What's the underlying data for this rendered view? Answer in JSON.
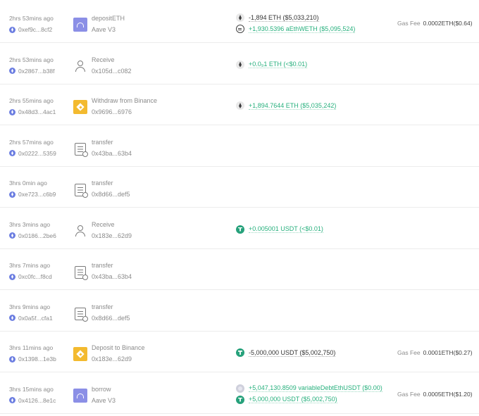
{
  "rows": [
    {
      "time": "2hrs 53mins ago",
      "hash": "0xef9c...8cf2",
      "icon": "aave-icon",
      "name": "depositETH",
      "sub": "Aave V3",
      "tokens": [
        {
          "icon": "eth-icon",
          "text": "-1,894 ETH ($5,033,210)",
          "direction": "out"
        },
        {
          "icon": "aeth-icon",
          "text": "+1,930.5396 aEthWETH ($5,095,524)",
          "direction": "in"
        }
      ],
      "gas_label": "Gas Fee",
      "gas_value": "0.0002ETH($0.64)"
    },
    {
      "time": "2hrs 53mins ago",
      "hash": "0x2867...b38f",
      "icon": "person-icon",
      "name": "Receive",
      "sub": "0x105d...c082",
      "tokens": [
        {
          "icon": "eth-icon",
          "text": "+0.0₉1 ETH (<$0.01)",
          "direction": "in"
        }
      ]
    },
    {
      "time": "2hrs 55mins ago",
      "hash": "0x48d3...4ac1",
      "icon": "binance-icon",
      "name": "Withdraw from Binance",
      "sub": "0x9696...6976",
      "tokens": [
        {
          "icon": "eth-icon",
          "text": "+1,894.7644 ETH ($5,035,242)",
          "direction": "in"
        }
      ]
    },
    {
      "time": "2hrs 57mins ago",
      "hash": "0x0222...5359",
      "icon": "contract-icon",
      "name": "transfer",
      "sub": "0x43ba...63b4",
      "tokens": []
    },
    {
      "time": "3hrs 0min ago",
      "hash": "0xe723...c6b9",
      "icon": "contract-icon",
      "name": "transfer",
      "sub": "0x8d66...def5",
      "tokens": []
    },
    {
      "time": "3hrs 3mins ago",
      "hash": "0x0186...2be6",
      "icon": "person-icon",
      "name": "Receive",
      "sub": "0x183e...62d9",
      "tokens": [
        {
          "icon": "usdt-icon",
          "text": "+0.005001 USDT (<$0.01)",
          "direction": "in"
        }
      ]
    },
    {
      "time": "3hrs 7mins ago",
      "hash": "0xc0fc...f8cd",
      "icon": "contract-icon",
      "name": "transfer",
      "sub": "0x43ba...63b4",
      "tokens": []
    },
    {
      "time": "3hrs 9mins ago",
      "hash": "0x0a5f...cfa1",
      "icon": "contract-icon",
      "name": "transfer",
      "sub": "0x8d66...def5",
      "tokens": []
    },
    {
      "time": "3hrs 11mins ago",
      "hash": "0x1398...1e3b",
      "icon": "binance-icon",
      "name": "Deposit to Binance",
      "sub": "0x183e...62d9",
      "tokens": [
        {
          "icon": "usdt-icon",
          "text": "-5,000,000 USDT ($5,002,750)",
          "direction": "out"
        }
      ],
      "gas_label": "Gas Fee",
      "gas_value": "0.0001ETH($0.27)"
    },
    {
      "time": "3hrs 15mins ago",
      "hash": "0x4126...8e1c",
      "icon": "aave-icon",
      "name": "borrow",
      "sub": "Aave V3",
      "tokens": [
        {
          "icon": "variable-debt-icon",
          "text": "+5,047,130.8509 variableDebtEthUSDT ($0.00)",
          "direction": "in"
        },
        {
          "icon": "usdt-icon",
          "text": "+5,000,000 USDT ($5,002,750)",
          "direction": "in"
        }
      ],
      "gas_label": "Gas Fee",
      "gas_value": "0.0005ETH($1.20)"
    }
  ]
}
